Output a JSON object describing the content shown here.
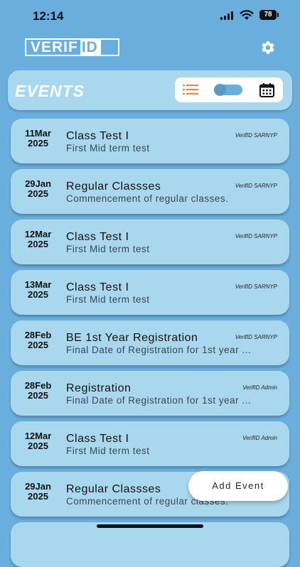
{
  "status_bar": {
    "time": "12:14",
    "battery": "78"
  },
  "logo": {
    "part1": "VERIF",
    "part2": "ID"
  },
  "header": {
    "title": "EVENTS"
  },
  "events": [
    {
      "day": "11Mar",
      "year": "2025",
      "title": "Class Test I",
      "description": "First Mid term test",
      "source": "VerifID SARNYP"
    },
    {
      "day": "29Jan",
      "year": "2025",
      "title": "Regular Classses",
      "description": "Commencement of regular classes.",
      "source": "VerifID SARNYP"
    },
    {
      "day": "12Mar",
      "year": "2025",
      "title": "Class Test I",
      "description": "First Mid term test",
      "source": "VerifID SARNYP"
    },
    {
      "day": "13Mar",
      "year": "2025",
      "title": "Class Test I",
      "description": "First Mid term test",
      "source": "VerifID SARNYP"
    },
    {
      "day": "28Feb",
      "year": "2025",
      "title": "BE 1st Year Registration",
      "description": "Final Date of Registration for 1st year ...",
      "source": "VerifID SARNYP"
    },
    {
      "day": "28Feb",
      "year": "2025",
      "title": "Registration",
      "description": "Final Date of Registration for 1st year ...",
      "source": "VerifID Admin"
    },
    {
      "day": "12Mar",
      "year": "2025",
      "title": "Class Test I",
      "description": "First Mid term test",
      "source": "VerifID Admin"
    },
    {
      "day": "29Jan",
      "year": "2025",
      "title": "Regular Classses",
      "description": "Commencement of regular classes.",
      "source": ""
    }
  ],
  "add_event": {
    "label": "Add Event"
  },
  "colors": {
    "background": "#6aaedd",
    "card": "#a9d8ee",
    "list_icon": "#e8874a"
  },
  "icons": [
    "cellular-signal-icon",
    "wifi-icon",
    "battery-icon",
    "gear-icon",
    "list-icon",
    "toggle-switch",
    "calendar-icon"
  ]
}
